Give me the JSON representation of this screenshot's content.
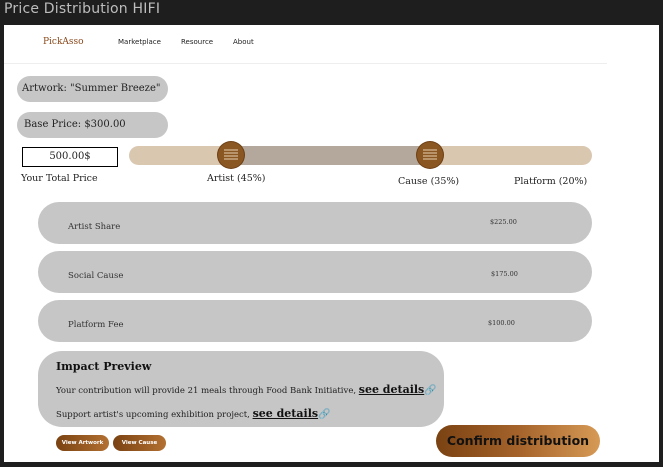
{
  "window": {
    "title": "Price Distribution HIFI"
  },
  "nav": {
    "logo": "PickAsso",
    "links": [
      "Marketplace",
      "Resource",
      "About"
    ]
  },
  "artwork": {
    "label": "Artwork: \"Summer Breeze\""
  },
  "base_price": {
    "label": "Base Price: $300.00"
  },
  "total_price": {
    "value": "500.00$",
    "label": "Your Total Price"
  },
  "slider": {
    "artist_label": "Artist (45%)",
    "cause_label": "Cause (35%)",
    "platform_label": "Platform (20%)",
    "artist_pct": 45,
    "cause_pct": 35,
    "platform_pct": 20
  },
  "shares": [
    {
      "label": "Artist Share",
      "value": "$225.00"
    },
    {
      "label": "Social Cause",
      "value": "$175.00"
    },
    {
      "label": "Platform Fee",
      "value": "$100.00"
    }
  ],
  "impact": {
    "title": "Impact Preview",
    "line1": "Your contribution will provide 21 meals through Food Bank Initiative,",
    "line2": "Support artist's upcoming exhibition project,",
    "details_label": "see details"
  },
  "buttons": {
    "view_artwork": "View Artwork",
    "view_cause": "View Cause",
    "confirm": "Confirm distribution"
  },
  "colors": {
    "accent": "#8a5622",
    "pill_bg": "#c6c6c6",
    "track_light": "#d9c7b0",
    "track_mid": "#b3a89b"
  },
  "icons": {
    "handle": "drag-lines-icon",
    "link": "link-icon"
  }
}
